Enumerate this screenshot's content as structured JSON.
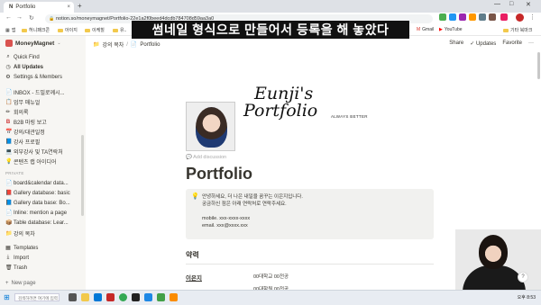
{
  "browser": {
    "tab_title": "Portfolio",
    "tab_close": "×",
    "new_tab": "+",
    "url": "notion.so/moneymagnet/Portfolio-22e1a2f0beed4dcdb784708d59aa3a0",
    "window_controls": [
      "—",
      "□",
      "✕"
    ]
  },
  "bookmarks": [
    "앱",
    "허니패크콘",
    "아이지",
    "이케힐",
    "유..",
    "Gmail",
    "YouTube",
    "기타 북마크"
  ],
  "caption": "썸네일 형식으로 만들어서 등록을 해 놓았다",
  "sidebar": {
    "workspace": "MoneyMagnet",
    "top_items": [
      {
        "icon": "search-icon",
        "glyph": "⌕",
        "label": "Quick Find"
      },
      {
        "icon": "clock-icon",
        "glyph": "◷",
        "label": "All Updates"
      },
      {
        "icon": "gear-icon",
        "glyph": "⚙",
        "label": "Settings & Members"
      }
    ],
    "pages": [
      {
        "glyph": "📄",
        "label": "INBOX - 드밀로께시..."
      },
      {
        "glyph": "📋",
        "label": "업무 매뉴얼"
      },
      {
        "glyph": "✏",
        "label": "회의록"
      },
      {
        "glyph": "B",
        "label": "B2B 마링 보고"
      },
      {
        "glyph": "📅",
        "label": "강의/대관일정"
      },
      {
        "glyph": "📘",
        "label": "강사 프로필"
      },
      {
        "glyph": "💻",
        "label": "외부강사 및 TA연락처"
      },
      {
        "glyph": "💡",
        "label": "콘텐츠 랩 아이디어"
      }
    ],
    "private_label": "PRIVATE",
    "private_pages": [
      {
        "glyph": "📄",
        "label": "board&calendar data..."
      },
      {
        "glyph": "📕",
        "label": "Gallery database: basic"
      },
      {
        "glyph": "📘",
        "label": "Gallery data base: Bo..."
      },
      {
        "glyph": "📄",
        "label": "Inline: mention a page"
      },
      {
        "glyph": "📦",
        "label": "Table database: Lear..."
      },
      {
        "glyph": "📁",
        "label": "강의 목차"
      }
    ],
    "bottom_items": [
      {
        "glyph": "▦",
        "label": "Templates"
      },
      {
        "glyph": "⤓",
        "label": "Import"
      },
      {
        "glyph": "🗑",
        "label": "Trash"
      }
    ],
    "new_page": "New page"
  },
  "topbar": {
    "breadcrumb": [
      "강의 목차",
      "Portfolio"
    ],
    "actions": [
      "Share",
      "✓ Updates",
      "Favorite",
      "···"
    ]
  },
  "page": {
    "cover_title_line1": "Eunji's",
    "cover_title_line2": "Portfolio",
    "cover_tagline": "ALWAYS BETTER",
    "add_discussion": "Add discussion",
    "title": "Portfolio",
    "callout_lines": [
      "안녕하세요, 더 나은 내일을 꿈꾸는 이은지입니다.",
      "궁금하신 점은 아래 연락처로 연락주세요.",
      "",
      "mobile. xxx-xxxx-xxxx",
      "email. xxx@xxxx.xxx"
    ],
    "career_heading": "약력",
    "name": "이은지",
    "school_1": "00대학교 00전공",
    "school_2": "00대학원 00전공"
  },
  "taskbar": {
    "search_placeholder": "검색하려면 여기에 입력",
    "clock": "오후 8:53"
  }
}
